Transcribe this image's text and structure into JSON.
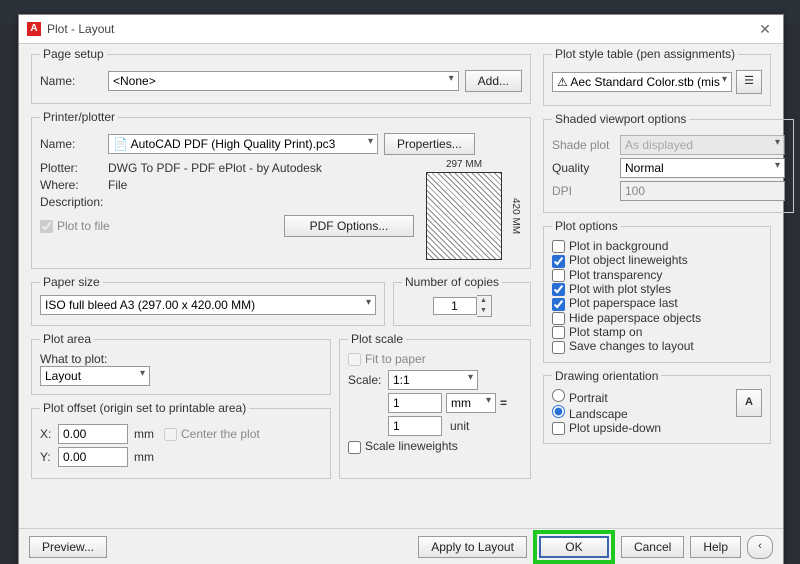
{
  "title": "Plot - Layout",
  "pageSetup": {
    "groupLabel": "Page setup",
    "nameLabel": "Name:",
    "nameValue": "<None>",
    "addBtn": "Add..."
  },
  "printer": {
    "groupLabel": "Printer/plotter",
    "nameLabel": "Name:",
    "nameValue": "AutoCAD PDF (High Quality Print).pc3",
    "propsBtn": "Properties...",
    "plotterLabel": "Plotter:",
    "plotterValue": "DWG To PDF - PDF ePlot - by Autodesk",
    "whereLabel": "Where:",
    "whereValue": "File",
    "descLabel": "Description:",
    "plotToFile": "Plot to file",
    "pdfOptions": "PDF Options...",
    "dim297": "297 MM",
    "dim420": "420 MM"
  },
  "paper": {
    "groupLabel": "Paper size",
    "value": "ISO full bleed A3 (297.00 x 420.00 MM)",
    "copiesLabel": "Number of copies",
    "copiesValue": "1"
  },
  "plotArea": {
    "groupLabel": "Plot area",
    "whatLabel": "What to plot:",
    "value": "Layout"
  },
  "plotScale": {
    "groupLabel": "Plot scale",
    "fitLabel": "Fit to paper",
    "scaleLabel": "Scale:",
    "scaleValue": "1:1",
    "mmValue": "1",
    "mmUnit": "mm",
    "unitValue": "1",
    "unitLabel": "unit",
    "scaleLW": "Scale lineweights"
  },
  "plotOffset": {
    "groupLabel": "Plot offset (origin set to printable area)",
    "xLabel": "X:",
    "yLabel": "Y:",
    "xValue": "0.00",
    "yValue": "0.00",
    "mm": "mm",
    "centerLabel": "Center the plot"
  },
  "plotStyle": {
    "groupLabel": "Plot style table (pen assignments)",
    "value": "Aec Standard Color.stb (mis"
  },
  "shaded": {
    "groupLabel": "Shaded viewport options",
    "shadeLabel": "Shade plot",
    "shadeValue": "As displayed",
    "qualityLabel": "Quality",
    "qualityValue": "Normal",
    "dpiLabel": "DPI",
    "dpiValue": "100"
  },
  "plotOptions": {
    "groupLabel": "Plot options",
    "bg": "Plot in background",
    "lw": "Plot object lineweights",
    "tr": "Plot transparency",
    "ps": "Plot with plot styles",
    "pl": "Plot paperspace last",
    "hp": "Hide paperspace objects",
    "st": "Plot stamp on",
    "sv": "Save changes to layout"
  },
  "orient": {
    "groupLabel": "Drawing orientation",
    "portrait": "Portrait",
    "landscape": "Landscape",
    "upside": "Plot upside-down"
  },
  "footer": {
    "preview": "Preview...",
    "apply": "Apply to Layout",
    "ok": "OK",
    "cancel": "Cancel",
    "help": "Help"
  }
}
